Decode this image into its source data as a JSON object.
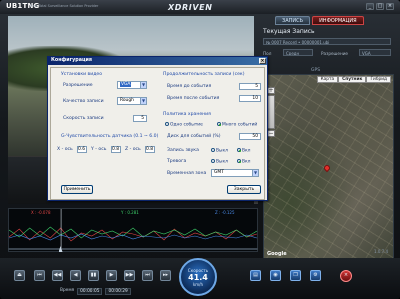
{
  "app": {
    "logo": "UB1TNG",
    "logo_sub": "Best Total Surveillance Solution Provider",
    "brand": "XDRIVEN",
    "window_buttons": [
      "_",
      "□",
      "×"
    ]
  },
  "right_panel": {
    "tabs": [
      {
        "label": "ЗАПИСЬ",
        "active": false
      },
      {
        "label": "ИНФОРМАЦИЯ",
        "active": true
      }
    ],
    "title": "Текущая Запись",
    "file_value": "№ 0007 Record • 00000001.ubi",
    "fields": [
      {
        "label": "Пол",
        "value": "Средн"
      },
      {
        "label": "Разрешение",
        "value": "VGA"
      }
    ],
    "gps_label": "GPS",
    "map_types": [
      "Карта",
      "Спутник",
      "Гибрид"
    ],
    "active_map_type": "Спутник",
    "map_brand": "Google",
    "pin_color": "#e0302a"
  },
  "waveform": {
    "x_value": "X : -0.078",
    "y_value": "Y : 0.281",
    "z_value": "Z : -0.125",
    "x_color": "#e04545",
    "y_color": "#3dd06a",
    "z_color": "#4a8ae8",
    "x_trace": [
      -0.2,
      0.6,
      -0.5,
      0.4,
      -0.3,
      0.7,
      -0.6,
      0.2,
      -0.1,
      0.5,
      -0.4,
      0.3,
      0.1,
      -0.2,
      0.4,
      -0.5,
      0.6,
      -0.3,
      0.2,
      -0.1,
      0.3,
      -0.4,
      0.5,
      -0.2,
      0.1
    ],
    "y_trace": [
      0.3,
      -0.4,
      0.5,
      -0.3,
      0.6,
      -0.2,
      0.4,
      -0.5,
      0.3,
      -0.1,
      0.2,
      -0.3,
      0.5,
      -0.4,
      0.2,
      -0.1,
      0.3,
      -0.2,
      0.4,
      -0.3,
      0.1,
      -0.2,
      0.3,
      -0.4,
      0.2
    ],
    "z_trace": [
      -0.1,
      0.2,
      -0.2,
      0.1,
      -0.3,
      0.2,
      -0.1,
      0.3,
      -0.2,
      0.1,
      -0.1,
      0.2,
      -0.2,
      0.1,
      0.0,
      -0.1,
      0.2,
      -0.1,
      0.1,
      -0.2,
      0.1,
      0.0,
      -0.1,
      0.2,
      -0.1
    ],
    "playhead_fraction": 0.21
  },
  "version": "1.0.7.4",
  "controls": {
    "buttons": [
      "⏏",
      "⏮",
      "◀◀",
      "◀",
      "▮▮",
      "▶",
      "▶▶",
      "⏭",
      "▸▸"
    ],
    "speed_label": "Скорость",
    "speed_value": "41.4",
    "speed_unit": "km/h",
    "time_label": "Время",
    "time_current": "00:00:05",
    "time_total": "00:00:29",
    "right_buttons": [
      "▤",
      "◉",
      "❐",
      "⚙"
    ],
    "close_symbol": "×"
  },
  "dialog": {
    "title": "Конфигурация",
    "close": "×",
    "video_section": "Установки видео",
    "resolution_label": "Разрешение",
    "resolution_value": "VGA",
    "quality_label": "Качество записи",
    "quality_value": "Rough",
    "rate_label": "Скорость записи",
    "rate_value": "5",
    "sensor_section": "G-Чувствительность датчика (0.1 ~ 6.0)",
    "x_label": "X - ось",
    "x_value": "0.6",
    "y_label": "Y - ось",
    "y_value": "0.8",
    "z_label": "Z - ось",
    "z_value": "0.8",
    "duration_section": "Продолжительность записи (сек)",
    "before_label": "Время до события",
    "before_value": "5",
    "after_label": "Время после события",
    "after_value": "10",
    "storage_section": "Политика хранения",
    "one_event": "Одно событие",
    "many_events": "Много событий",
    "disk_label": "Диск для событий (%)",
    "disk_value": "50",
    "sound_label": "Запись звука",
    "alarm_label": "Тревога",
    "off_label": "Выкл",
    "on_label": "Вкл",
    "timezone_label": "Временная зона",
    "timezone_value": "GMT",
    "apply": "Применить",
    "close_btn": "Закрыть"
  }
}
